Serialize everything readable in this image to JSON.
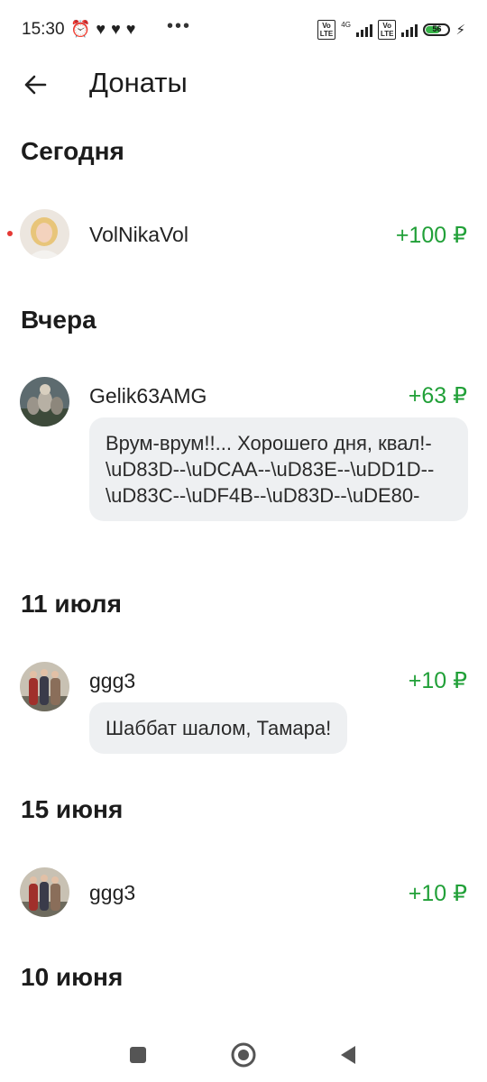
{
  "status_bar": {
    "time": "15:30",
    "battery": "56"
  },
  "header": {
    "title": "Донаты"
  },
  "sections": [
    {
      "title": "Сегодня",
      "items": [
        {
          "name": "VolNikaVol",
          "amount": "+100 ₽",
          "unread": true,
          "message": ""
        }
      ]
    },
    {
      "title": "Вчера",
      "items": [
        {
          "name": "Gelik63AMG",
          "amount": "+63 ₽",
          "unread": false,
          "message": "Врум-врум!!... Хорошего дня, квал!-\\uD83D--\\uDCAA--\\uD83E--\\uDD1D--\\uD83C--\\uDF4B--\\uD83D--\\uDE80-"
        }
      ]
    },
    {
      "title": "11 июля",
      "items": [
        {
          "name": "ggg3",
          "amount": "+10 ₽",
          "unread": false,
          "message": "Шаббат шалом, Тамара!"
        }
      ]
    },
    {
      "title": "15 июня",
      "items": [
        {
          "name": "ggg3",
          "amount": "+10 ₽",
          "unread": false,
          "message": ""
        }
      ]
    },
    {
      "title": "10 июня",
      "items": []
    }
  ],
  "colors": {
    "amount": "#21a038",
    "bubble": "#eef0f2",
    "unread": "#e53935"
  },
  "icons": {
    "back": "arrow-left-icon",
    "nav_recent": "square-icon",
    "nav_home": "circle-icon",
    "nav_back": "triangle-icon"
  }
}
